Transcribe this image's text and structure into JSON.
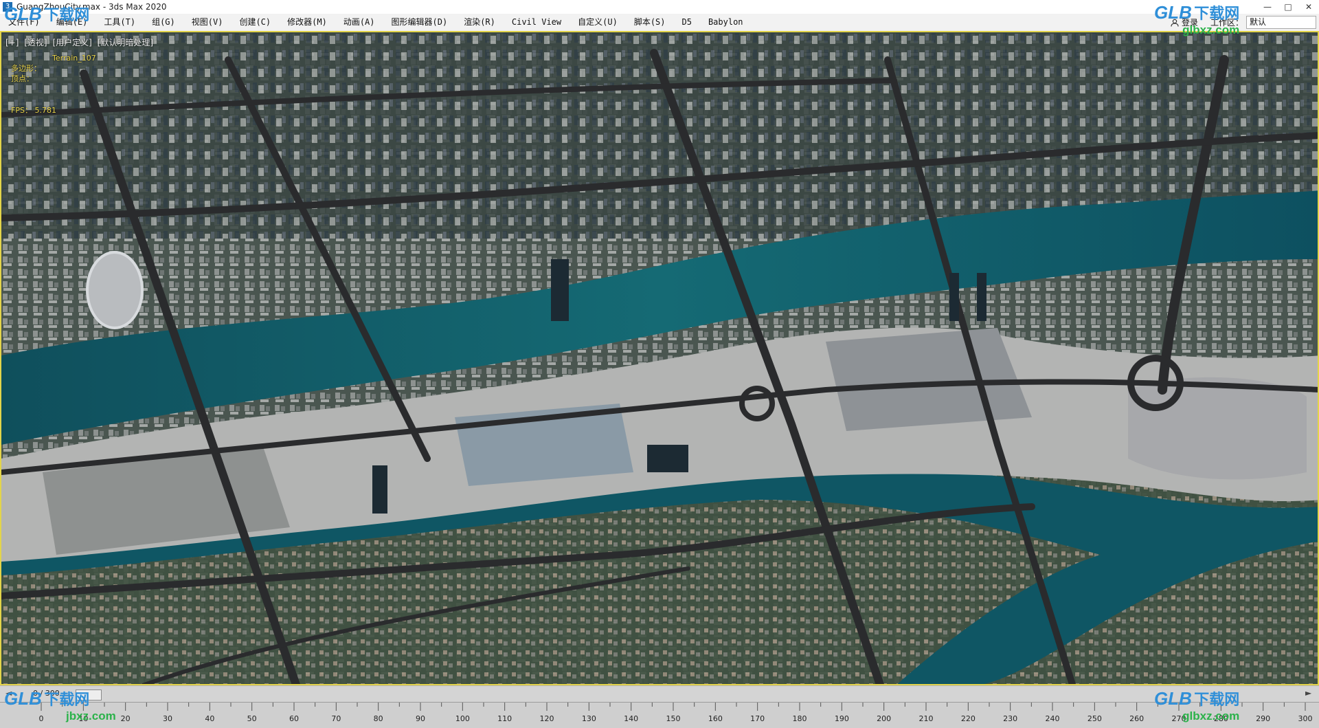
{
  "window": {
    "title": "GuangZhouCity.max - 3ds Max 2020",
    "app_icon": "3",
    "minimize": "—",
    "maximize": "□",
    "close": "✕"
  },
  "menu": {
    "items": [
      "文件(F)",
      "编辑(E)",
      "工具(T)",
      "组(G)",
      "视图(V)",
      "创建(C)",
      "修改器(M)",
      "动画(A)",
      "图形编辑器(D)",
      "渲染(R)",
      "Civil View",
      "自定义(U)",
      "脚本(S)",
      "D5",
      "Babylon"
    ],
    "login": "登录",
    "workspace_label": "工作区：",
    "workspace_value": "默认"
  },
  "viewport": {
    "label_parts": [
      "[+]",
      "[透视]",
      "[用户定义]",
      "[默认明暗处理]"
    ],
    "object_name": "Terrain_107",
    "stats": [
      {
        "key": "多边形：",
        "value": ""
      },
      {
        "key": "顶点：",
        "value": ""
      }
    ],
    "fps_label": "FPS：",
    "fps_value": "5.781",
    "river_color": "#0e5a66",
    "ground_color": "#3b4a3f",
    "road_color": "#2c2c2e",
    "island_color": "#b9b9b9"
  },
  "timeline": {
    "frame_counter": "0 / 300",
    "prev_icon": "chevron-left-icon",
    "next_icon": "chevron-right-icon",
    "ruler_labels": [
      "0",
      "10",
      "20",
      "30",
      "40",
      "50",
      "60",
      "70",
      "80",
      "90",
      "100",
      "110",
      "120",
      "130",
      "140",
      "150",
      "160",
      "170",
      "180",
      "190",
      "200",
      "210",
      "220",
      "230",
      "240",
      "250",
      "260",
      "270",
      "280",
      "290",
      "300"
    ]
  },
  "watermark": {
    "logo": "GLB",
    "cn": "下载网",
    "url": "glbxz.com",
    "partial_url": "jbxz.com"
  }
}
